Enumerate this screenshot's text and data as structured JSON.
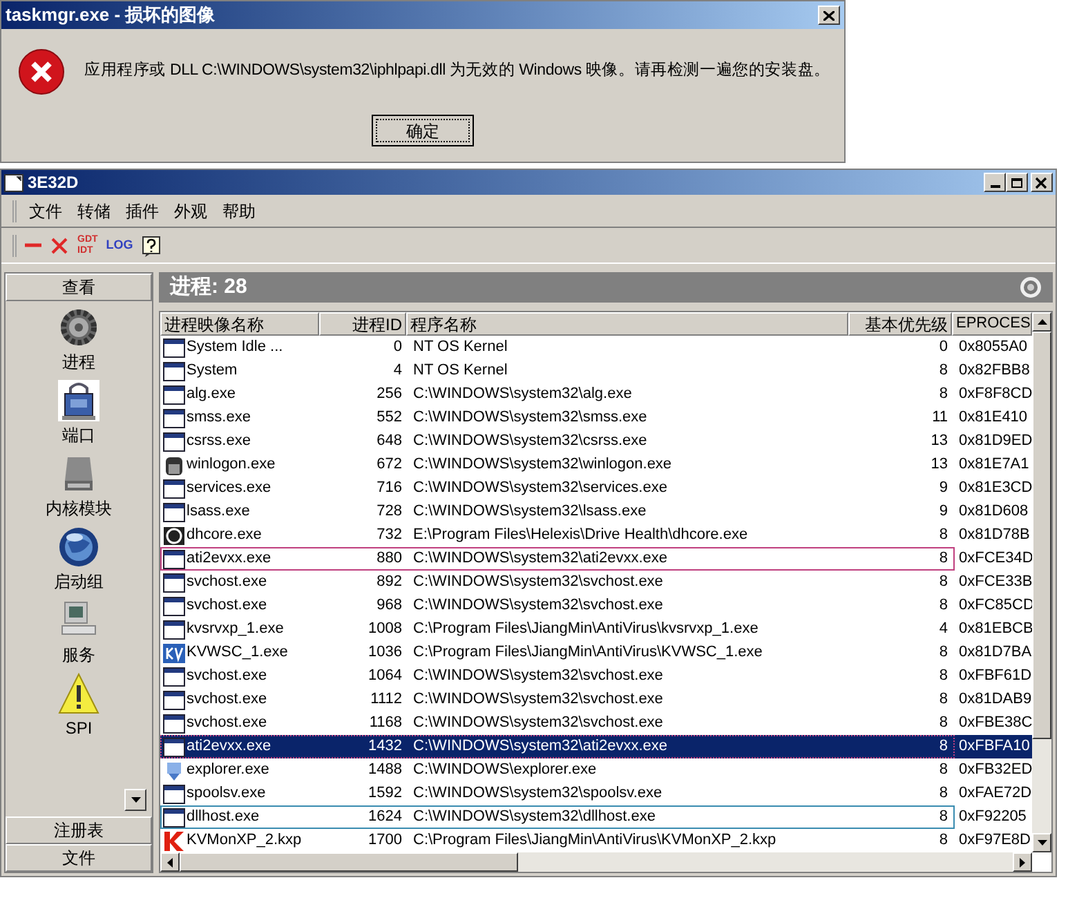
{
  "dialog": {
    "title": "taskmgr.exe - 损坏的图像",
    "message": "应用程序或 DLL C:\\WINDOWS\\system32\\iphlpapi.dll 为无效的 Windows 映像。请再检测一遍您的安装盘。",
    "button": "确定"
  },
  "window": {
    "title": "3E32D"
  },
  "menu": [
    "文件",
    "转储",
    "插件",
    "外观",
    "帮助"
  ],
  "toolbar": {
    "gdt_idt": [
      "GDT",
      "IDT"
    ],
    "log": "LOG"
  },
  "sidebar": {
    "header": "查看",
    "items": [
      {
        "kind": "gear",
        "label": "进程"
      },
      {
        "kind": "lock",
        "label": "端口"
      },
      {
        "kind": "drive",
        "label": "内核模块"
      },
      {
        "kind": "globe",
        "label": "启动组"
      },
      {
        "kind": "computer",
        "label": "服务"
      },
      {
        "kind": "warning",
        "label": "SPI"
      }
    ],
    "sections": [
      "注册表",
      "文件"
    ]
  },
  "panel": {
    "title": "进程: 28"
  },
  "table": {
    "columns": [
      "进程映像名称",
      "进程ID",
      "程序名称",
      "基本优先级",
      "EPROCES"
    ],
    "rows": [
      {
        "kind": "window",
        "name": "System Idle ...",
        "pid": "0",
        "path": "NT OS Kernel",
        "priority": "0",
        "eprocess": "0x8055A0",
        "selected": false
      },
      {
        "kind": "window",
        "name": "System",
        "pid": "4",
        "path": "NT OS Kernel",
        "priority": "8",
        "eprocess": "0x82FBB8",
        "selected": false
      },
      {
        "kind": "window",
        "name": "alg.exe",
        "pid": "256",
        "path": "C:\\WINDOWS\\system32\\alg.exe",
        "priority": "8",
        "eprocess": "0xF8F8CD",
        "selected": false
      },
      {
        "kind": "window",
        "name": "smss.exe",
        "pid": "552",
        "path": "C:\\WINDOWS\\system32\\smss.exe",
        "priority": "11",
        "eprocess": "0x81E410",
        "selected": false
      },
      {
        "kind": "window",
        "name": "csrss.exe",
        "pid": "648",
        "path": "C:\\WINDOWS\\system32\\csrss.exe",
        "priority": "13",
        "eprocess": "0x81D9ED",
        "selected": false
      },
      {
        "kind": "winlogon",
        "name": "winlogon.exe",
        "pid": "672",
        "path": "C:\\WINDOWS\\system32\\winlogon.exe",
        "priority": "13",
        "eprocess": "0x81E7A1",
        "selected": false
      },
      {
        "kind": "window",
        "name": "services.exe",
        "pid": "716",
        "path": "C:\\WINDOWS\\system32\\services.exe",
        "priority": "9",
        "eprocess": "0x81E3CD",
        "selected": false
      },
      {
        "kind": "window",
        "name": "lsass.exe",
        "pid": "728",
        "path": "C:\\WINDOWS\\system32\\lsass.exe",
        "priority": "9",
        "eprocess": "0x81D608",
        "selected": false
      },
      {
        "kind": "disc",
        "name": "dhcore.exe",
        "pid": "732",
        "path": "E:\\Program Files\\Helexis\\Drive Health\\dhcore.exe",
        "priority": "8",
        "eprocess": "0x81D78B",
        "selected": false
      },
      {
        "kind": "window",
        "name": "ati2evxx.exe",
        "pid": "880",
        "path": "C:\\WINDOWS\\system32\\ati2evxx.exe",
        "priority": "8",
        "eprocess": "0xFCE34D",
        "selected": false,
        "color": "#c0407f"
      },
      {
        "kind": "window",
        "name": "svchost.exe",
        "pid": "892",
        "path": "C:\\WINDOWS\\system32\\svchost.exe",
        "priority": "8",
        "eprocess": "0xFCE33B",
        "selected": false
      },
      {
        "kind": "window",
        "name": "svchost.exe",
        "pid": "968",
        "path": "C:\\WINDOWS\\system32\\svchost.exe",
        "priority": "8",
        "eprocess": "0xFC85CD",
        "selected": false
      },
      {
        "kind": "window",
        "name": "kvsrvxp_1.exe",
        "pid": "1008",
        "path": "C:\\Program Files\\JiangMin\\AntiVirus\\kvsrvxp_1.exe",
        "priority": "4",
        "eprocess": "0x81EBCB",
        "selected": false
      },
      {
        "kind": "kv",
        "name": "KVWSC_1.exe",
        "pid": "1036",
        "path": "C:\\Program Files\\JiangMin\\AntiVirus\\KVWSC_1.exe",
        "priority": "8",
        "eprocess": "0x81D7BA",
        "selected": false
      },
      {
        "kind": "window",
        "name": "svchost.exe",
        "pid": "1064",
        "path": "C:\\WINDOWS\\system32\\svchost.exe",
        "priority": "8",
        "eprocess": "0xFBF61D",
        "selected": false
      },
      {
        "kind": "window",
        "name": "svchost.exe",
        "pid": "1112",
        "path": "C:\\WINDOWS\\system32\\svchost.exe",
        "priority": "8",
        "eprocess": "0x81DAB9",
        "selected": false
      },
      {
        "kind": "window",
        "name": "svchost.exe",
        "pid": "1168",
        "path": "C:\\WINDOWS\\system32\\svchost.exe",
        "priority": "8",
        "eprocess": "0xFBE38C",
        "selected": false
      },
      {
        "kind": "window",
        "name": "ati2evxx.exe",
        "pid": "1432",
        "path": "C:\\WINDOWS\\system32\\ati2evxx.exe",
        "priority": "8",
        "eprocess": "0xFBFA10",
        "selected": true,
        "color": "#c0407f"
      },
      {
        "kind": "explorer",
        "name": "explorer.exe",
        "pid": "1488",
        "path": "C:\\WINDOWS\\explorer.exe",
        "priority": "8",
        "eprocess": "0xFB32ED",
        "selected": false
      },
      {
        "kind": "window",
        "name": "spoolsv.exe",
        "pid": "1592",
        "path": "C:\\WINDOWS\\system32\\spoolsv.exe",
        "priority": "8",
        "eprocess": "0xFAE72D",
        "selected": false
      },
      {
        "kind": "window",
        "name": "dllhost.exe",
        "pid": "1624",
        "path": "C:\\WINDOWS\\system32\\dllhost.exe",
        "priority": "8",
        "eprocess": "0xF92205",
        "selected": false,
        "color": "#3a8cb0"
      },
      {
        "kind": "k",
        "name": "KVMonXP_2.kxp",
        "pid": "1700",
        "path": "C:\\Program Files\\JiangMin\\AntiVirus\\KVMonXP_2.kxp",
        "priority": "8",
        "eprocess": "0xF97E8D",
        "selected": false
      }
    ]
  }
}
